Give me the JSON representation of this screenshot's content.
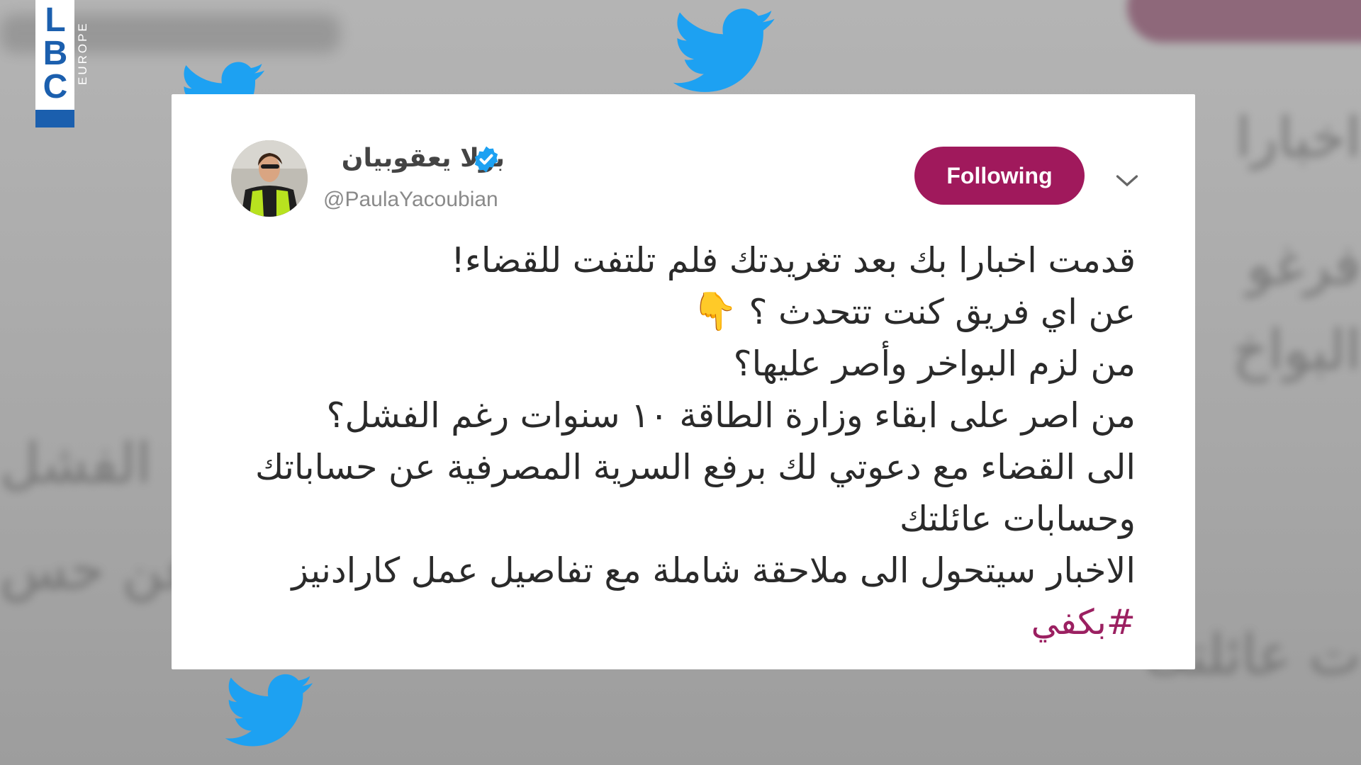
{
  "brand": {
    "logo_letters": [
      "L",
      "B",
      "C"
    ],
    "logo_subtext": "EUROPE",
    "logo_color": "#1b5fae"
  },
  "background": {
    "blurred_lines": [
      "اخبارا",
      "فرغو",
      "البواخ",
      "الفشل",
      "عن حس",
      "ت عائلتك"
    ]
  },
  "tweet": {
    "display_name": "بولا يعقوبيان",
    "handle": "@PaulaYacoubian",
    "verified": true,
    "follow_button_label": "Following",
    "follow_button_color": "#a0195c",
    "lines": [
      "قدمت اخبارا بك بعد تغريدتك فلم تلتفت للقضاء!",
      "عن اي فريق كنت تتحدث ؟",
      "من لزم البواخر وأصر عليها؟",
      "من اصر على ابقاء وزارة الطاقة ١٠ سنوات رغم الفشل؟",
      "الى القضاء مع دعوتي لك برفع السرية المصرفية عن حساباتك",
      "وحسابات عائلتك",
      "الاخبار سيتحول الى ملاحقة شاملة مع تفاصيل عمل كارادنيز"
    ],
    "hashtag": "#بكفي",
    "icons": {
      "verified": "verified-badge-icon",
      "chevron": "chevron-down-icon",
      "emoji": "pointing-down-hand-icon"
    },
    "emoji_glyph": "👇"
  },
  "decorations": {
    "bird_color": "#1da1f2",
    "bird_icon": "twitter-bird-icon"
  }
}
